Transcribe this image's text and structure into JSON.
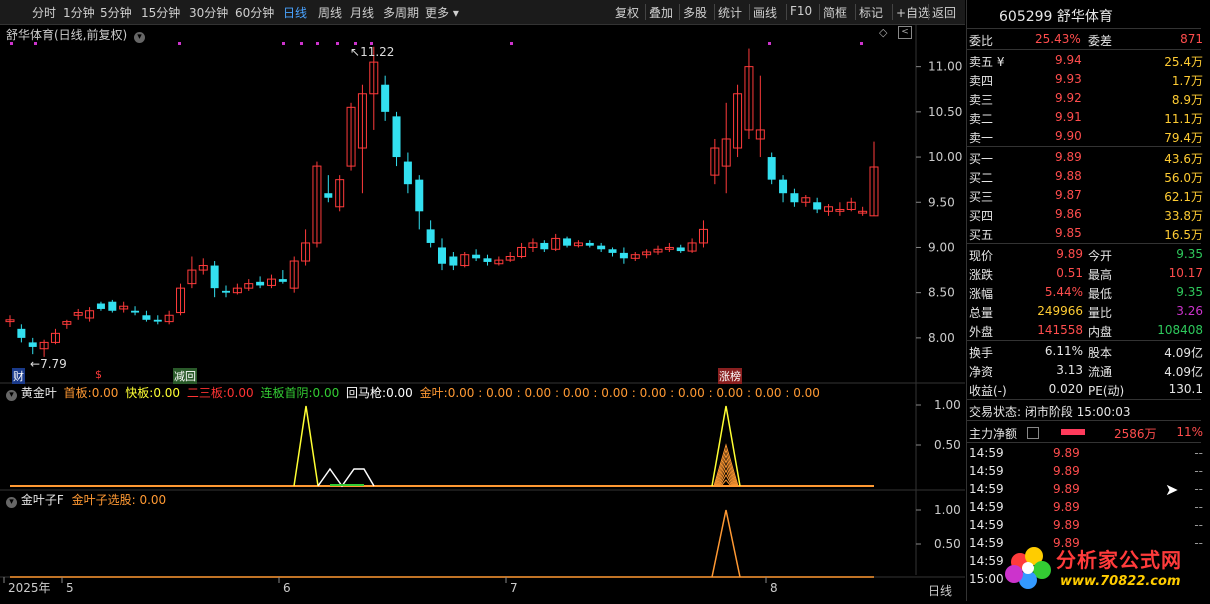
{
  "toolbar": {
    "left_items": [
      "分时",
      "1分钟",
      "5分钟",
      "15分钟",
      "30分钟",
      "60分钟",
      "日线",
      "周线",
      "月线",
      "多周期",
      "更多 ▾"
    ],
    "active_index": 6,
    "right_items": [
      "复权",
      "叠加",
      "多股",
      "统计",
      "画线",
      "F10",
      "简框",
      "标记",
      "+自选",
      "返回"
    ]
  },
  "main_chart": {
    "title": "舒华体育(日线,前复权)",
    "price_ticks": [
      "11.00",
      "10.50",
      "10.00",
      "9.50",
      "9.00",
      "8.50",
      "8.00"
    ],
    "high_label": "11.22",
    "low_label": "7.79",
    "markers": {
      "cai": "财",
      "s": "$",
      "jianhui": "减回",
      "zhangbang": "涨榜"
    }
  },
  "indicator1": {
    "name": "黄金叶",
    "items": [
      {
        "label": "首板:",
        "value": "0.00",
        "color": "#ff9933"
      },
      {
        "label": "快板:",
        "value": "0.00",
        "color": "#ffff33"
      },
      {
        "label": "二三板:",
        "value": "0.00",
        "color": "#ff3333"
      },
      {
        "label": "连板首阴:",
        "value": "0.00",
        "color": "#33cc33"
      },
      {
        "label": "回马枪:",
        "value": "0.00",
        "color": "#ffffff"
      },
      {
        "label": "金叶:",
        "value": "0.00 : 0.00 : 0.00 : 0.00 : 0.00 : 0.00 : 0.00 : 0.00 : 0.00 : 0.00",
        "color": "#ff9933"
      }
    ],
    "ticks": [
      "1.00",
      "0.50"
    ]
  },
  "indicator2": {
    "name": "金叶子F",
    "item_label": "金叶子选股:",
    "item_value": "0.00",
    "ticks": [
      "1.00",
      "0.50"
    ]
  },
  "x_axis": {
    "labels": [
      "2025年",
      "5",
      "6",
      "7",
      "8"
    ],
    "period": "日线"
  },
  "quote": {
    "code": "605299",
    "name": "舒华体育",
    "weibi_label": "委比",
    "weibi": "25.43%",
    "weicha_label": "委差",
    "weicha": "871",
    "asks": [
      {
        "label": "卖五 ¥",
        "price": "9.94",
        "vol": "25.4万"
      },
      {
        "label": "卖四",
        "price": "9.93",
        "vol": "1.7万"
      },
      {
        "label": "卖三",
        "price": "9.92",
        "vol": "8.9万"
      },
      {
        "label": "卖二",
        "price": "9.91",
        "vol": "11.1万"
      },
      {
        "label": "卖一",
        "price": "9.90",
        "vol": "79.4万"
      }
    ],
    "bids": [
      {
        "label": "买一",
        "price": "9.89",
        "vol": "43.6万"
      },
      {
        "label": "买二",
        "price": "9.88",
        "vol": "56.0万"
      },
      {
        "label": "买三",
        "price": "9.87",
        "vol": "62.1万"
      },
      {
        "label": "买四",
        "price": "9.86",
        "vol": "33.8万"
      },
      {
        "label": "买五",
        "price": "9.85",
        "vol": "16.5万"
      }
    ],
    "stats": [
      {
        "l1": "现价",
        "v1": "9.89",
        "c1": "red",
        "l2": "今开",
        "v2": "9.35",
        "c2": "green"
      },
      {
        "l1": "涨跌",
        "v1": "0.51",
        "c1": "red",
        "l2": "最高",
        "v2": "10.17",
        "c2": "red"
      },
      {
        "l1": "涨幅",
        "v1": "5.44%",
        "c1": "red",
        "l2": "最低",
        "v2": "9.35",
        "c2": "green"
      },
      {
        "l1": "总量",
        "v1": "249966",
        "c1": "yellow",
        "l2": "量比",
        "v2": "3.26",
        "c2": "purple"
      },
      {
        "l1": "外盘",
        "v1": "141558",
        "c1": "red",
        "l2": "内盘",
        "v2": "108408",
        "c2": "green"
      }
    ],
    "stats2": [
      {
        "l1": "换手",
        "v1": "6.11%",
        "l2": "股本",
        "v2": "4.09亿"
      },
      {
        "l1": "净资",
        "v1": "3.13",
        "l2": "流通",
        "v2": "4.09亿"
      },
      {
        "l1": "收益(-)",
        "v1": "0.020",
        "l2": "PE(动)",
        "v2": "130.1"
      }
    ],
    "trade_status": "交易状态: 闭市阶段 15:00:03",
    "mainforce_label": "主力净额",
    "mainforce_value": "2586万",
    "mainforce_pct": "11%",
    "ticks": [
      {
        "time": "14:59",
        "price": "9.89",
        "vol": "--"
      },
      {
        "time": "14:59",
        "price": "9.89",
        "vol": "--"
      },
      {
        "time": "14:59",
        "price": "9.89",
        "vol": "--"
      },
      {
        "time": "14:59",
        "price": "9.89",
        "vol": "--"
      },
      {
        "time": "14:59",
        "price": "9.89",
        "vol": "--"
      },
      {
        "time": "14:59",
        "price": "9.89",
        "vol": "--"
      },
      {
        "time": "14:59",
        "price": "",
        "vol": ""
      },
      {
        "time": "15:00",
        "price": "",
        "vol": ""
      }
    ]
  },
  "watermark": {
    "brand": "分析家公式网",
    "url": "www.70822.com"
  },
  "colors": {
    "up": "#ff3b3b",
    "down": "#33e0f0",
    "ma": "#ffffff"
  },
  "chart_data": {
    "type": "candlestick",
    "ohlc": [
      [
        8.18,
        8.25,
        8.12,
        8.2
      ],
      [
        8.1,
        8.15,
        7.95,
        8.0
      ],
      [
        7.95,
        8.0,
        7.82,
        7.9
      ],
      [
        7.88,
        7.98,
        7.79,
        7.95
      ],
      [
        7.95,
        8.1,
        7.93,
        8.05
      ],
      [
        8.15,
        8.2,
        8.1,
        8.18
      ],
      [
        8.25,
        8.32,
        8.2,
        8.28
      ],
      [
        8.22,
        8.34,
        8.18,
        8.3
      ],
      [
        8.38,
        8.4,
        8.3,
        8.32
      ],
      [
        8.4,
        8.42,
        8.28,
        8.3
      ],
      [
        8.32,
        8.4,
        8.28,
        8.35
      ],
      [
        8.3,
        8.35,
        8.25,
        8.28
      ],
      [
        8.25,
        8.3,
        8.18,
        8.2
      ],
      [
        8.2,
        8.25,
        8.15,
        8.18
      ],
      [
        8.18,
        8.3,
        8.15,
        8.25
      ],
      [
        8.28,
        8.6,
        8.25,
        8.55
      ],
      [
        8.6,
        8.9,
        8.55,
        8.75
      ],
      [
        8.75,
        8.88,
        8.7,
        8.8
      ],
      [
        8.8,
        8.85,
        8.45,
        8.55
      ],
      [
        8.52,
        8.58,
        8.45,
        8.5
      ],
      [
        8.5,
        8.6,
        8.48,
        8.55
      ],
      [
        8.55,
        8.65,
        8.52,
        8.6
      ],
      [
        8.62,
        8.68,
        8.55,
        8.58
      ],
      [
        8.58,
        8.7,
        8.55,
        8.65
      ],
      [
        8.65,
        8.75,
        8.6,
        8.62
      ],
      [
        8.55,
        8.9,
        8.5,
        8.85
      ],
      [
        8.85,
        9.2,
        8.8,
        9.05
      ],
      [
        9.05,
        9.95,
        9.0,
        9.9
      ],
      [
        9.6,
        9.8,
        9.5,
        9.55
      ],
      [
        9.45,
        9.8,
        9.4,
        9.75
      ],
      [
        9.9,
        10.6,
        9.85,
        10.55
      ],
      [
        10.1,
        10.8,
        9.6,
        10.7
      ],
      [
        10.7,
        11.22,
        10.3,
        11.05
      ],
      [
        10.8,
        10.9,
        10.4,
        10.5
      ],
      [
        10.45,
        10.5,
        9.9,
        10.0
      ],
      [
        9.95,
        10.05,
        9.6,
        9.7
      ],
      [
        9.75,
        9.8,
        9.2,
        9.4
      ],
      [
        9.2,
        9.3,
        9.0,
        9.05
      ],
      [
        9.0,
        9.1,
        8.75,
        8.82
      ],
      [
        8.9,
        8.95,
        8.75,
        8.8
      ],
      [
        8.8,
        8.95,
        8.78,
        8.92
      ],
      [
        8.92,
        8.98,
        8.85,
        8.88
      ],
      [
        8.88,
        8.92,
        8.8,
        8.84
      ],
      [
        8.82,
        8.9,
        8.8,
        8.86
      ],
      [
        8.86,
        8.95,
        8.84,
        8.9
      ],
      [
        8.9,
        9.05,
        8.88,
        9.0
      ],
      [
        9.0,
        9.1,
        8.95,
        9.05
      ],
      [
        9.05,
        9.08,
        8.95,
        8.98
      ],
      [
        8.98,
        9.15,
        8.96,
        9.1
      ],
      [
        9.1,
        9.12,
        9.0,
        9.02
      ],
      [
        9.02,
        9.08,
        9.0,
        9.05
      ],
      [
        9.05,
        9.08,
        9.0,
        9.02
      ],
      [
        9.02,
        9.05,
        8.95,
        8.98
      ],
      [
        8.98,
        9.0,
        8.9,
        8.94
      ],
      [
        8.94,
        9.0,
        8.82,
        8.88
      ],
      [
        8.88,
        8.95,
        8.85,
        8.92
      ],
      [
        8.92,
        8.98,
        8.88,
        8.95
      ],
      [
        8.95,
        9.02,
        8.92,
        8.98
      ],
      [
        8.98,
        9.05,
        8.95,
        9.0
      ],
      [
        9.0,
        9.03,
        8.94,
        8.96
      ],
      [
        8.96,
        9.1,
        8.94,
        9.05
      ],
      [
        9.05,
        9.3,
        9.0,
        9.2
      ],
      [
        9.8,
        10.2,
        9.7,
        10.1
      ],
      [
        9.9,
        10.6,
        9.6,
        10.2
      ],
      [
        10.1,
        10.8,
        10.0,
        10.7
      ],
      [
        10.3,
        11.2,
        10.2,
        11.0
      ],
      [
        10.2,
        10.9,
        10.0,
        10.3
      ],
      [
        10.0,
        10.05,
        9.7,
        9.75
      ],
      [
        9.75,
        9.8,
        9.5,
        9.6
      ],
      [
        9.6,
        9.65,
        9.45,
        9.5
      ],
      [
        9.5,
        9.58,
        9.45,
        9.55
      ],
      [
        9.5,
        9.55,
        9.38,
        9.42
      ],
      [
        9.4,
        9.48,
        9.35,
        9.45
      ],
      [
        9.4,
        9.5,
        9.35,
        9.42
      ],
      [
        9.42,
        9.55,
        9.4,
        9.5
      ],
      [
        9.38,
        9.45,
        9.35,
        9.4
      ],
      [
        9.35,
        10.17,
        9.35,
        9.89
      ]
    ],
    "ylim": [
      7.7,
      11.35
    ],
    "x_ticks": [
      "2025年",
      "5",
      "6",
      "7",
      "8"
    ]
  }
}
